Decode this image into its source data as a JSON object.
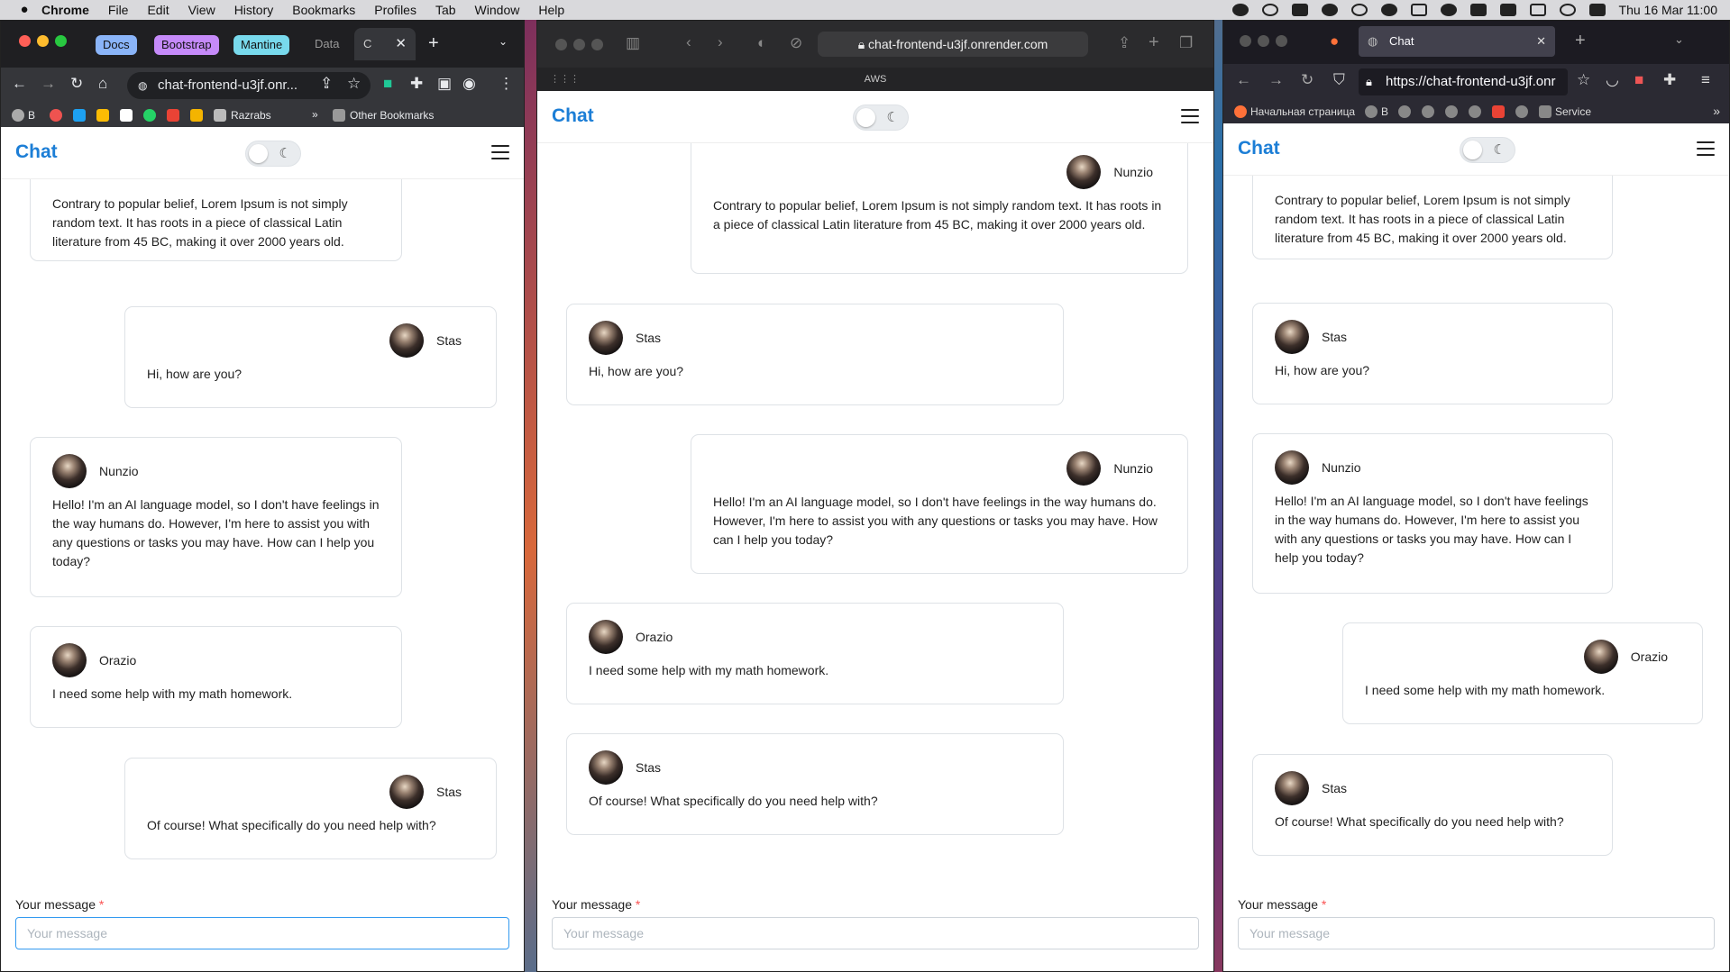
{
  "menubar": {
    "apple": "",
    "items": [
      "Chrome",
      "File",
      "Edit",
      "View",
      "History",
      "Bookmarks",
      "Profiles",
      "Tab",
      "Window",
      "Help"
    ],
    "clock": "Thu 16 Mar  11:00"
  },
  "chrome": {
    "tab_groups": [
      "Docs",
      "Bootstrap",
      "Mantine"
    ],
    "tab_partial": "Data",
    "active_tab_initial": "C",
    "url": "chat-frontend-u3jf.onr...",
    "bookmarks": [
      "B",
      "Razrabs",
      "Other Bookmarks"
    ],
    "overflow": "»"
  },
  "safari": {
    "url": "chat-frontend-u3jf.onrender.com",
    "tab_label": "AWS"
  },
  "firefox": {
    "tab_title": "Chat",
    "url": "https://chat-frontend-u3jf.onr",
    "bookmarks": [
      "Начальная страница",
      "B",
      "Service"
    ]
  },
  "app": {
    "logo": "Chat",
    "moon": "☾",
    "field_label": "Your message",
    "required_mark": "*",
    "placeholder": "Your message"
  },
  "messages": [
    {
      "user": "Nunzio",
      "text": "Contrary to popular belief, Lorem Ipsum is not simply random text. It has roots in a piece of classical Latin literature from 45 BC, making it over 2000 years old."
    },
    {
      "user": "Stas",
      "text": "Hi, how are you?"
    },
    {
      "user": "Nunzio",
      "text": "Hello! I'm an AI language model, so I don't have feelings in the way humans do. However, I'm here to assist you with any questions or tasks you may have. How can I help you today?"
    },
    {
      "user": "Orazio",
      "text": "I need some help with my math homework."
    },
    {
      "user": "Stas",
      "text": "Of course! What specifically do you need help with?"
    }
  ],
  "colors": {
    "brand": "#1c7ed6",
    "required": "#fa5252"
  }
}
